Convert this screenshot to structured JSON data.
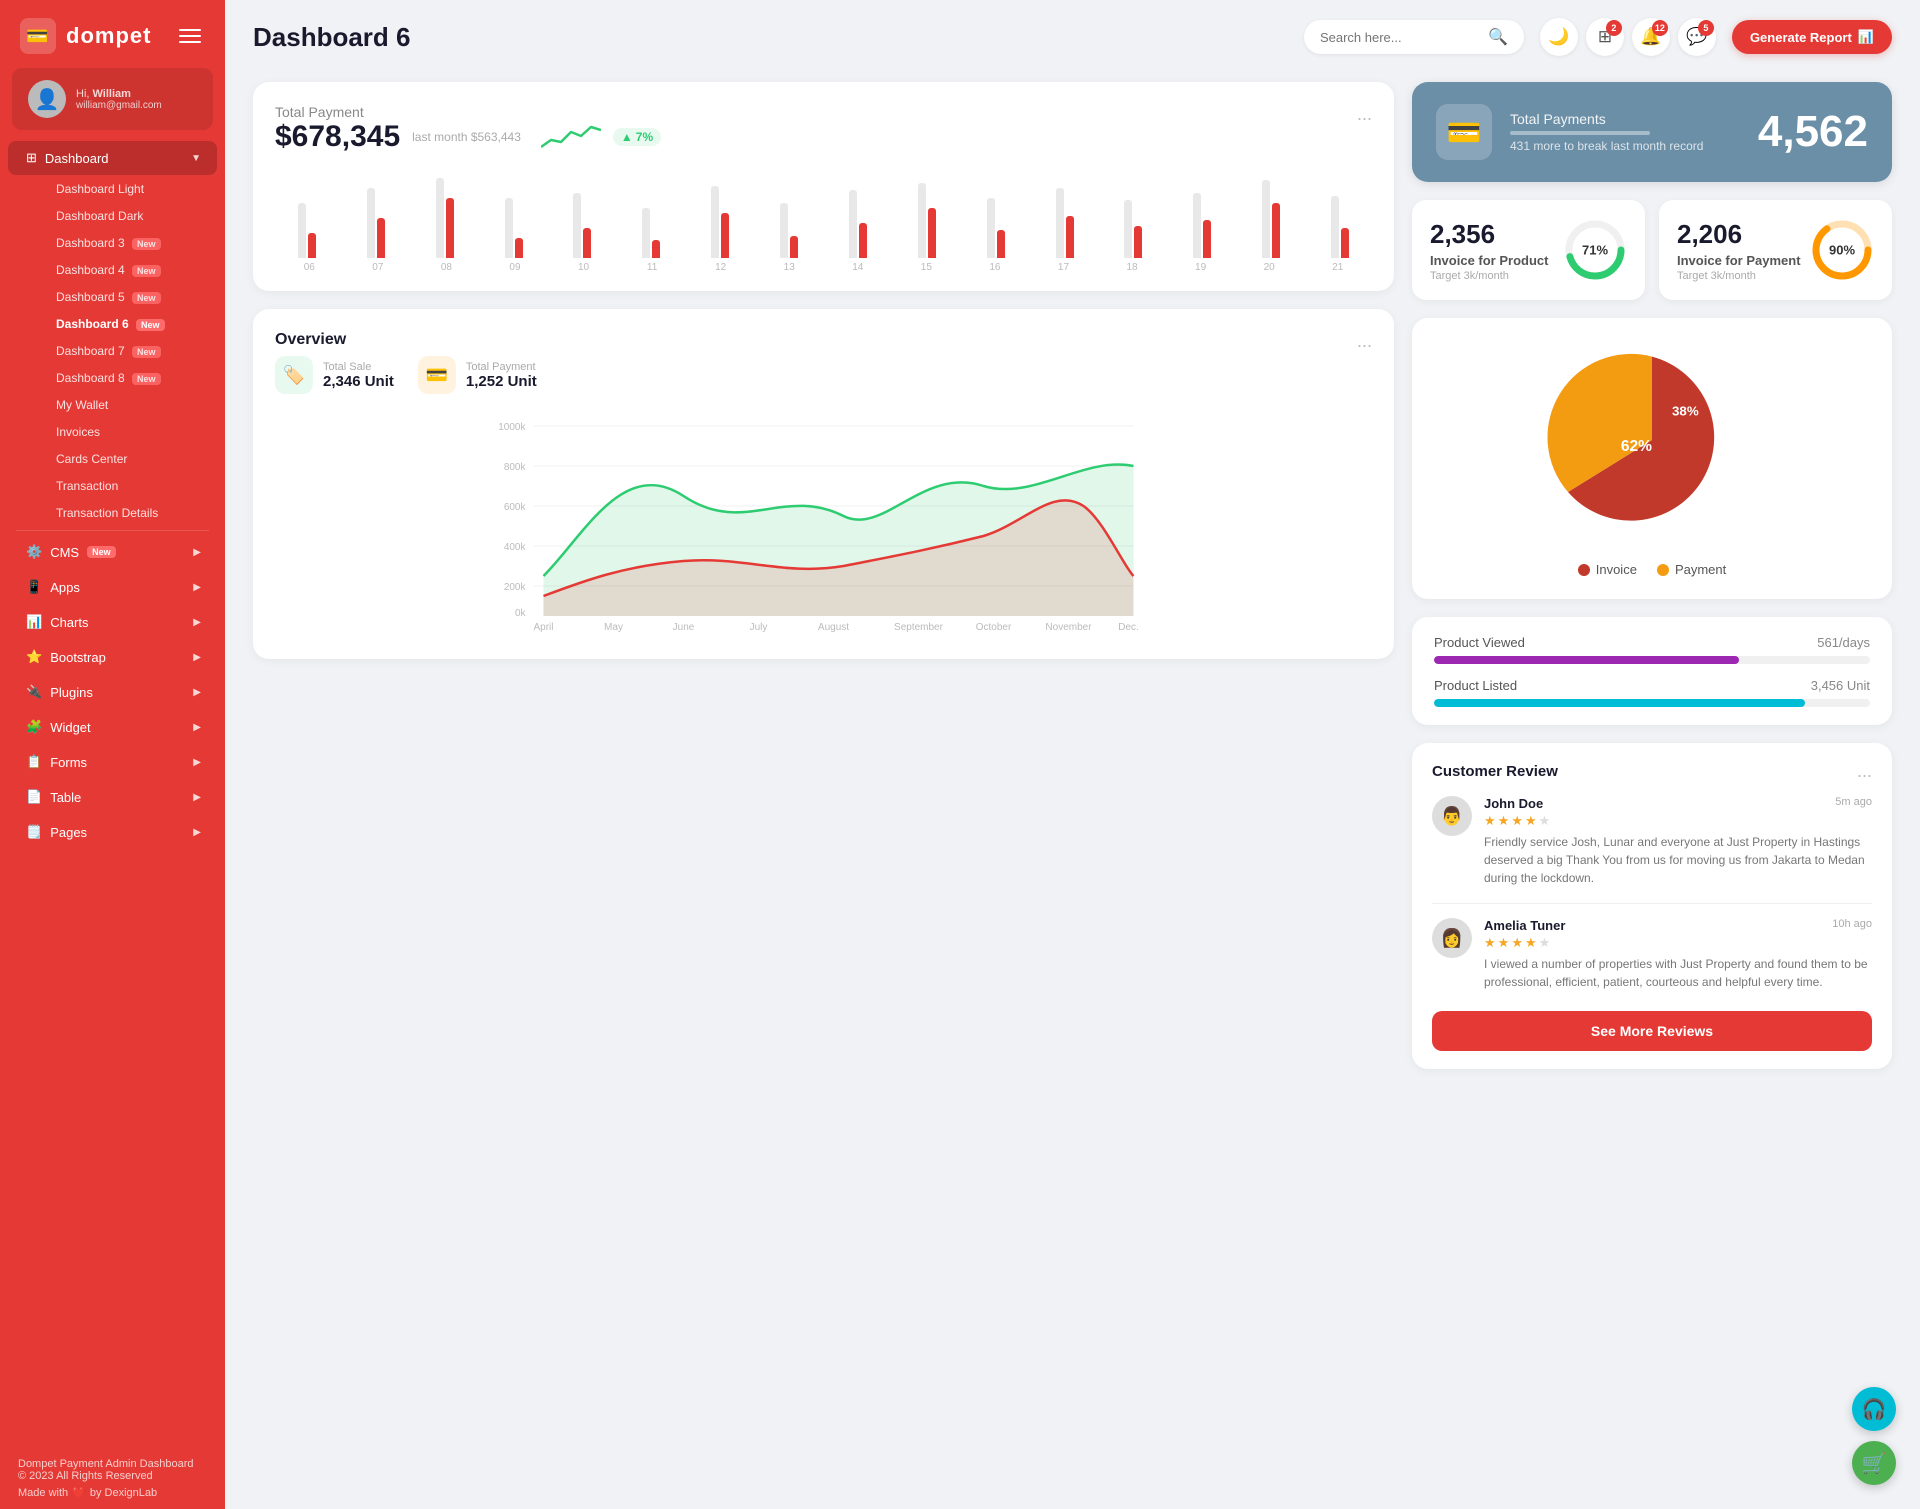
{
  "app": {
    "name": "dompet",
    "logo_icon": "💳"
  },
  "user": {
    "greeting": "Hi,",
    "name": "William",
    "email": "william@gmail.com",
    "avatar": "👤"
  },
  "sidebar": {
    "dashboard_label": "Dashboard",
    "items": [
      {
        "label": "Dashboard Light",
        "id": "dashboard-light",
        "active": false,
        "badge": null
      },
      {
        "label": "Dashboard Dark",
        "id": "dashboard-dark",
        "active": false,
        "badge": null
      },
      {
        "label": "Dashboard 3",
        "id": "dashboard-3",
        "active": false,
        "badge": "New"
      },
      {
        "label": "Dashboard 4",
        "id": "dashboard-4",
        "active": false,
        "badge": "New"
      },
      {
        "label": "Dashboard 5",
        "id": "dashboard-5",
        "active": false,
        "badge": "New"
      },
      {
        "label": "Dashboard 6",
        "id": "dashboard-6",
        "active": true,
        "badge": "New"
      },
      {
        "label": "Dashboard 7",
        "id": "dashboard-7",
        "active": false,
        "badge": "New"
      },
      {
        "label": "Dashboard 8",
        "id": "dashboard-8",
        "active": false,
        "badge": "New"
      },
      {
        "label": "My Wallet",
        "id": "my-wallet",
        "active": false,
        "badge": null
      },
      {
        "label": "Invoices",
        "id": "invoices",
        "active": false,
        "badge": null
      },
      {
        "label": "Cards Center",
        "id": "cards-center",
        "active": false,
        "badge": null
      },
      {
        "label": "Transaction",
        "id": "transaction",
        "active": false,
        "badge": null
      },
      {
        "label": "Transaction Details",
        "id": "transaction-details",
        "active": false,
        "badge": null
      }
    ],
    "nav": [
      {
        "label": "CMS",
        "id": "cms",
        "badge": "New",
        "icon": "⚙️"
      },
      {
        "label": "Apps",
        "id": "apps",
        "badge": null,
        "icon": "📱"
      },
      {
        "label": "Charts",
        "id": "charts",
        "badge": null,
        "icon": "📊"
      },
      {
        "label": "Bootstrap",
        "id": "bootstrap",
        "badge": null,
        "icon": "⭐"
      },
      {
        "label": "Plugins",
        "id": "plugins",
        "badge": null,
        "icon": "🔌"
      },
      {
        "label": "Widget",
        "id": "widget",
        "badge": null,
        "icon": "🧩"
      },
      {
        "label": "Forms",
        "id": "forms",
        "badge": null,
        "icon": "📋"
      },
      {
        "label": "Table",
        "id": "table",
        "badge": null,
        "icon": "📄"
      },
      {
        "label": "Pages",
        "id": "pages",
        "badge": null,
        "icon": "🗒️"
      }
    ],
    "footer": {
      "title": "Dompet Payment Admin Dashboard",
      "copyright": "© 2023 All Rights Reserved",
      "made_with": "Made with",
      "by": "by DexignLab"
    }
  },
  "header": {
    "title": "Dashboard 6",
    "search_placeholder": "Search here...",
    "icons": {
      "theme_icon": "🌙",
      "apps_badge": "2",
      "bell_badge": "12",
      "chat_badge": "5"
    },
    "generate_btn": "Generate Report"
  },
  "total_payment": {
    "title": "Total Payment",
    "amount": "$678,345",
    "last_month_label": "last month $563,443",
    "trend_pct": "7%",
    "menu": "...",
    "bars": [
      {
        "label": "06",
        "gray": 55,
        "red": 25
      },
      {
        "label": "07",
        "gray": 70,
        "red": 40
      },
      {
        "label": "08",
        "gray": 80,
        "red": 60
      },
      {
        "label": "09",
        "gray": 60,
        "red": 20
      },
      {
        "label": "10",
        "gray": 65,
        "red": 30
      },
      {
        "label": "11",
        "gray": 50,
        "red": 18
      },
      {
        "label": "12",
        "gray": 72,
        "red": 45
      },
      {
        "label": "13",
        "gray": 55,
        "red": 22
      },
      {
        "label": "14",
        "gray": 68,
        "red": 35
      },
      {
        "label": "15",
        "gray": 75,
        "red": 50
      },
      {
        "label": "16",
        "gray": 60,
        "red": 28
      },
      {
        "label": "17",
        "gray": 70,
        "red": 42
      },
      {
        "label": "18",
        "gray": 58,
        "red": 32
      },
      {
        "label": "19",
        "gray": 65,
        "red": 38
      },
      {
        "label": "20",
        "gray": 78,
        "red": 55
      },
      {
        "label": "21",
        "gray": 62,
        "red": 30
      }
    ]
  },
  "total_payments_blue": {
    "title": "Total Payments",
    "sub": "431 more to break last month record",
    "value": "4,562",
    "icon": "💳"
  },
  "invoice_product": {
    "value": "2,356",
    "label": "Invoice for Product",
    "target": "Target 3k/month",
    "pct": 71,
    "color": "#2ecc71"
  },
  "invoice_payment": {
    "value": "2,206",
    "label": "Invoice for Payment",
    "target": "Target 3k/month",
    "pct": 90,
    "color": "#ff9800"
  },
  "overview": {
    "title": "Overview",
    "menu": "...",
    "total_sale_label": "Total Sale",
    "total_sale_value": "2,346 Unit",
    "total_payment_label": "Total Payment",
    "total_payment_value": "1,252 Unit",
    "months": [
      "April",
      "May",
      "June",
      "July",
      "August",
      "September",
      "October",
      "November",
      "Dec."
    ],
    "y_labels": [
      "0k",
      "200k",
      "400k",
      "600k",
      "800k",
      "1000k"
    ]
  },
  "pie_chart": {
    "invoice_pct": "62%",
    "payment_pct": "38%",
    "invoice_color": "#c0392b",
    "payment_color": "#f39c12",
    "legend": [
      {
        "label": "Invoice",
        "color": "#c0392b"
      },
      {
        "label": "Payment",
        "color": "#f39c12"
      }
    ]
  },
  "product_stats": {
    "items": [
      {
        "label": "Product Viewed",
        "value": "561/days",
        "fill_pct": 70,
        "color": "#9c27b0"
      },
      {
        "label": "Product Listed",
        "value": "3,456 Unit",
        "fill_pct": 85,
        "color": "#00bcd4"
      }
    ]
  },
  "customer_review": {
    "title": "Customer Review",
    "menu": "...",
    "btn_label": "See More Reviews",
    "reviews": [
      {
        "name": "John Doe",
        "time": "5m ago",
        "stars": 4,
        "text": "Friendly service Josh, Lunar and everyone at Just Property in Hastings deserved a big Thank You from us for moving us from Jakarta to Medan during the lockdown.",
        "avatar": "👨"
      },
      {
        "name": "Amelia Tuner",
        "time": "10h ago",
        "stars": 4,
        "text": "I viewed a number of properties with Just Property and found them to be professional, efficient, patient, courteous and helpful every time.",
        "avatar": "👩"
      }
    ]
  },
  "fab": [
    {
      "icon": "🎧",
      "color": "teal",
      "id": "support-fab"
    },
    {
      "icon": "🛒",
      "color": "green",
      "id": "cart-fab"
    }
  ]
}
